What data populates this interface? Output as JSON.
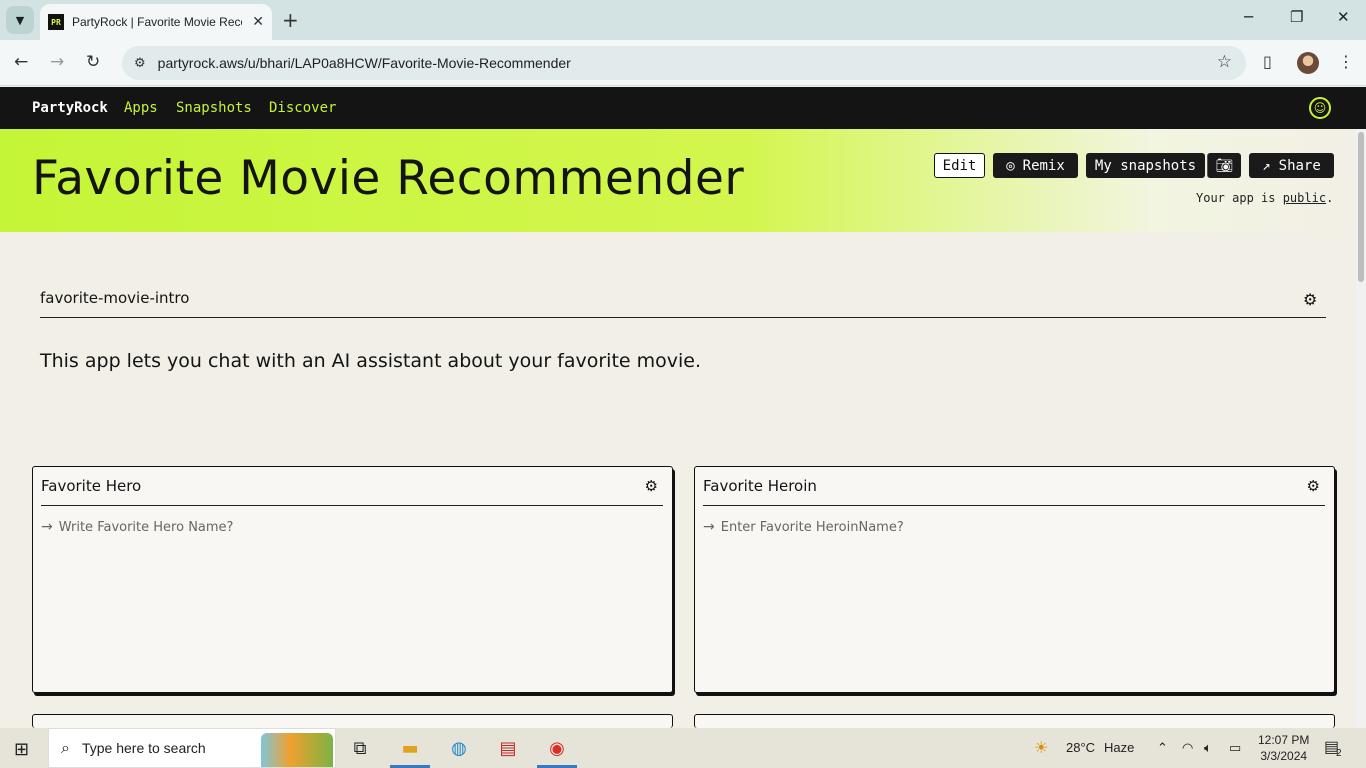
{
  "browser": {
    "tab_title": "PartyRock | Favorite Movie Recommender",
    "favicon_text": "PR",
    "url": "partyrock.aws/u/bhari/LAP0a8HCW/Favorite-Movie-Recommender"
  },
  "app_nav": {
    "logo": "PartyRock",
    "links": [
      "Apps",
      "Snapshots",
      "Discover"
    ]
  },
  "hero": {
    "title": "Favorite Movie Recommender",
    "buttons": {
      "edit": "Edit",
      "remix": "Remix",
      "my_snapshots": "My snapshots",
      "share": "Share"
    },
    "public_prefix": "Your app is ",
    "public_link": "public",
    "public_suffix": "."
  },
  "intro": {
    "heading": "favorite-movie-intro",
    "text": "This app lets you chat with an AI assistant about your favorite movie."
  },
  "widgets": [
    {
      "title": "Favorite Hero",
      "placeholder": "Write Favorite Hero Name?"
    },
    {
      "title": "Favorite Heroin",
      "placeholder": "Enter Favorite HeroinName?"
    }
  ],
  "taskbar": {
    "search_placeholder": "Type here to search",
    "weather_temp": "28°C",
    "weather_desc": "Haze",
    "time": "12:07 PM",
    "date": "3/3/2024",
    "notification_count": "2"
  },
  "colors": {
    "accent_lime": "#c5f537",
    "nav_bg": "#141414",
    "page_bg": "#f2efe6"
  }
}
